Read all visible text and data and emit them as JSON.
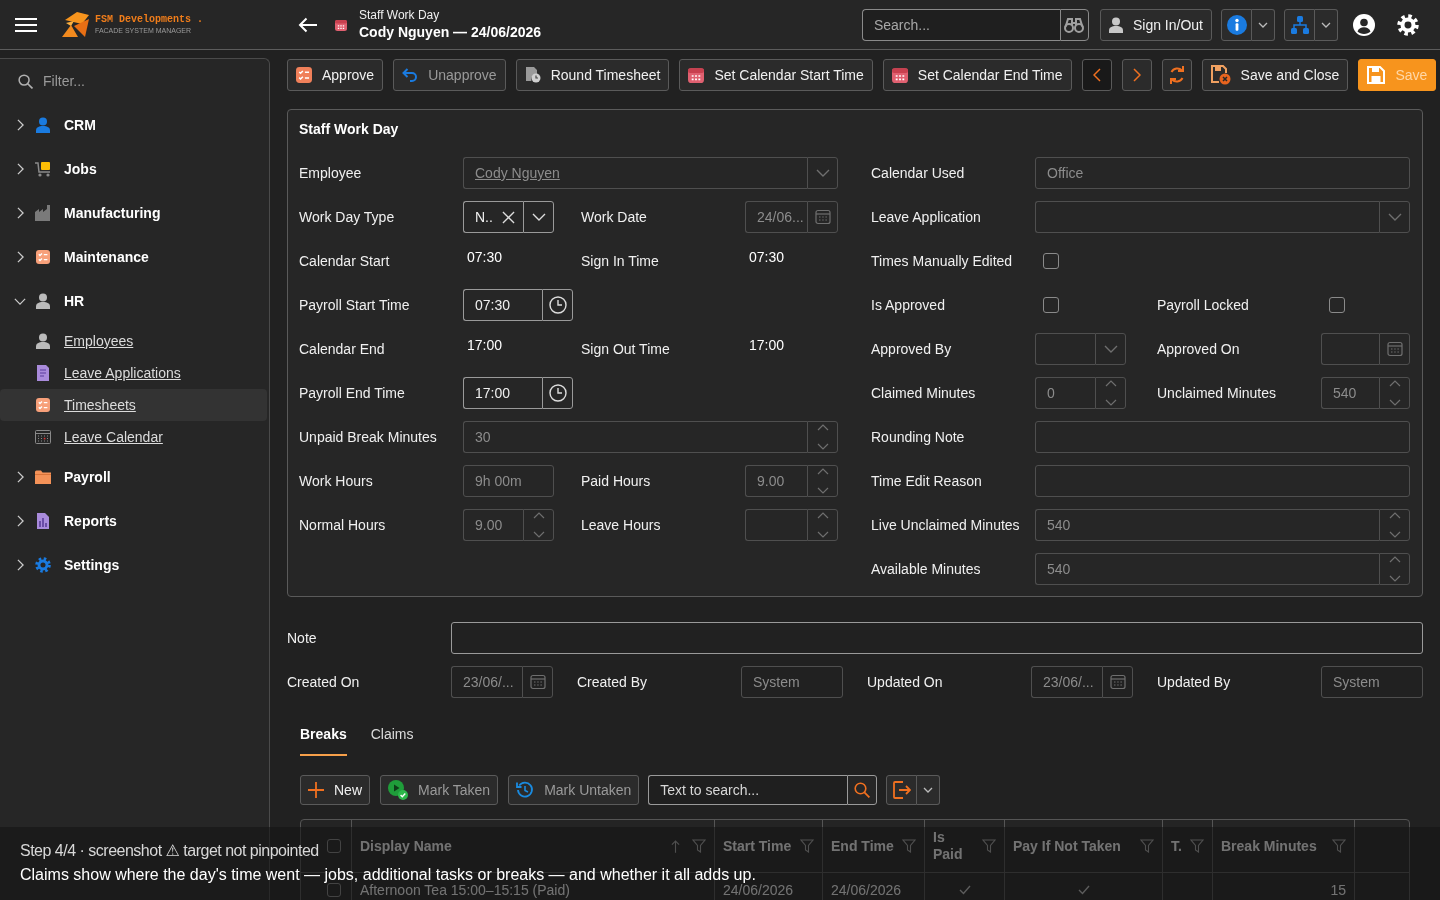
{
  "app": {
    "name": "FSM Developments .",
    "tagline": "FACADE SYSTEM MANAGER"
  },
  "header": {
    "subtitle": "Staff Work Day",
    "title": "Cody Nguyen — 24/06/2026"
  },
  "top_search": {
    "placeholder": "Search..."
  },
  "sign_in_button": {
    "label": "Sign In/Out"
  },
  "sidebar": {
    "filter": {
      "placeholder": "Filter..."
    },
    "items": [
      {
        "label": "CRM",
        "expanded": false
      },
      {
        "label": "Jobs",
        "expanded": false
      },
      {
        "label": "Manufacturing",
        "expanded": false
      },
      {
        "label": "Maintenance",
        "expanded": false
      },
      {
        "label": "HR",
        "expanded": true,
        "children": [
          {
            "label": "Employees",
            "selected": false
          },
          {
            "label": "Leave Applications",
            "selected": false
          },
          {
            "label": "Timesheets",
            "selected": true
          },
          {
            "label": "Leave Calendar",
            "selected": false
          }
        ]
      },
      {
        "label": "Payroll",
        "expanded": false
      },
      {
        "label": "Reports",
        "expanded": false
      },
      {
        "label": "Settings",
        "expanded": false
      }
    ]
  },
  "toolbar": {
    "actions": [
      {
        "label": "Approve",
        "disabled": false
      },
      {
        "label": "Unapprove",
        "disabled": true
      },
      {
        "label": "Round Timesheet",
        "disabled": false
      },
      {
        "label": "Set Calendar Start Time",
        "disabled": false
      },
      {
        "label": "Set Calendar End Time",
        "disabled": false
      }
    ],
    "nav_buttons": [
      {
        "kind": "previous",
        "focused": true
      },
      {
        "kind": "next",
        "focused": false
      },
      {
        "kind": "refresh",
        "focused": false
      }
    ],
    "save_buttons": [
      {
        "label": "Save and Close",
        "primary": false,
        "disabled": false
      },
      {
        "label": "Save",
        "primary": true,
        "disabled": true
      }
    ]
  },
  "form": {
    "title": "Staff Work Day",
    "left_rows": [
      {
        "fields": [
          {
            "label": "Employee",
            "kind": "combo",
            "value": "Cody Nguyen",
            "link": true,
            "disabled": true
          }
        ]
      },
      {
        "fields": [
          {
            "label": "Work Day Type",
            "kind": "combo",
            "value": "N..",
            "clearable": true,
            "disabled": false
          },
          {
            "label": "Work Date",
            "kind": "date",
            "value": "24/06...",
            "disabled": true
          }
        ]
      },
      {
        "fields": [
          {
            "label": "Calendar Start",
            "kind": "display",
            "value": "07:30"
          },
          {
            "label": "Sign In Time",
            "kind": "display",
            "value": "07:30"
          }
        ]
      },
      {
        "fields": [
          {
            "label": "Payroll Start Time",
            "kind": "time",
            "value": "07:30",
            "disabled": false
          }
        ]
      },
      {
        "fields": [
          {
            "label": "Calendar End",
            "kind": "display",
            "value": "17:00"
          },
          {
            "label": "Sign Out Time",
            "kind": "display",
            "value": "17:00"
          }
        ]
      },
      {
        "fields": [
          {
            "label": "Payroll End Time",
            "kind": "time",
            "value": "17:00",
            "disabled": false
          }
        ]
      },
      {
        "fields": [
          {
            "label": "Unpaid Break Minutes",
            "kind": "spin",
            "value": "30",
            "disabled": true
          }
        ]
      },
      {
        "fields": [
          {
            "label": "Work Hours",
            "kind": "text",
            "value": "9h 00m",
            "disabled": true
          },
          {
            "label": "Paid Hours",
            "kind": "spin",
            "value": "9.00",
            "disabled": true
          }
        ]
      },
      {
        "fields": [
          {
            "label": "Normal Hours",
            "kind": "spin",
            "value": "9.00",
            "disabled": true
          },
          {
            "label": "Leave Hours",
            "kind": "spin",
            "disabled": true
          }
        ]
      }
    ],
    "right_rows": [
      {
        "fields": [
          {
            "label": "Calendar Used",
            "kind": "text",
            "value": "Office",
            "disabled": true
          }
        ]
      },
      {
        "fields": [
          {
            "label": "Leave Application",
            "kind": "combo",
            "disabled": true
          }
        ]
      },
      {
        "fields": [
          {
            "label": "Times Manually Edited",
            "kind": "checkbox",
            "checked": false
          }
        ]
      },
      {
        "fields": [
          {
            "label": "Is Approved",
            "kind": "checkbox",
            "checked": false
          },
          {
            "label": "Payroll Locked",
            "kind": "checkbox",
            "checked": false
          }
        ]
      },
      {
        "fields": [
          {
            "label": "Approved By",
            "kind": "combo",
            "disabled": true
          },
          {
            "label": "Approved On",
            "kind": "date",
            "disabled": true
          }
        ]
      },
      {
        "fields": [
          {
            "label": "Claimed Minutes",
            "kind": "spin",
            "value": "0",
            "disabled": true
          },
          {
            "label": "Unclaimed Minutes",
            "kind": "spin",
            "value": "540",
            "disabled": true
          }
        ]
      },
      {
        "fields": [
          {
            "label": "Rounding Note",
            "kind": "text",
            "disabled": true
          }
        ]
      },
      {
        "fields": [
          {
            "label": "Time Edit Reason",
            "kind": "text",
            "disabled": true
          }
        ]
      },
      {
        "fields": [
          {
            "label": "Live Unclaimed Minutes",
            "kind": "spin",
            "value": "540",
            "disabled": true
          }
        ]
      },
      {
        "fields": [
          {
            "label": "Available Minutes",
            "kind": "spin",
            "value": "540",
            "disabled": true
          }
        ]
      }
    ]
  },
  "note": {
    "label": "Note",
    "disabled": false
  },
  "audit": [
    {
      "label": "Created On",
      "kind": "date",
      "value": "23/06/...",
      "disabled": true
    },
    {
      "label": "Created By",
      "kind": "text",
      "value": "System",
      "disabled": true
    },
    {
      "label": "Updated On",
      "kind": "date",
      "value": "23/06/...",
      "disabled": true
    },
    {
      "label": "Updated By",
      "kind": "text",
      "value": "System",
      "disabled": true
    }
  ],
  "tabs": [
    {
      "label": "Breaks",
      "selected": true
    },
    {
      "label": "Claims",
      "selected": false
    }
  ],
  "grid_toolbar": {
    "buttons": [
      {
        "label": "New",
        "disabled": false
      },
      {
        "label": "Mark Taken",
        "disabled": true
      },
      {
        "label": "Mark Untaken",
        "disabled": true
      }
    ],
    "search": {
      "placeholder": "Text to search..."
    }
  },
  "table": {
    "all_selected": false,
    "columns": [
      {
        "label": "Display Name",
        "sorted": true
      },
      {
        "label": "Start Time",
        "sorted": false
      },
      {
        "label": "End Time",
        "sorted": false
      },
      {
        "label": "Is Paid",
        "sorted": false
      },
      {
        "label": "Pay If Not Taken",
        "sorted": false
      },
      {
        "label": "T.",
        "sorted": false
      },
      {
        "label": "Break Minutes",
        "sorted": false
      }
    ],
    "rows": [
      {
        "selected": false,
        "cells": [
          {
            "text": "Afternoon Tea 15:00–15:15 (Paid)"
          },
          {
            "text": "24/06/2026"
          },
          {
            "text": "24/06/2026"
          },
          {
            "checked": true
          },
          {
            "checked": true
          },
          {
            "checked": false
          },
          {
            "text": "15"
          }
        ]
      }
    ]
  },
  "tour_caption": {
    "step": "Step 4/4 · screenshot ⚠ target not pinpointed",
    "text": "Claims show where the day's time went — jobs, additional tasks or breaks — and whether it all adds up."
  }
}
